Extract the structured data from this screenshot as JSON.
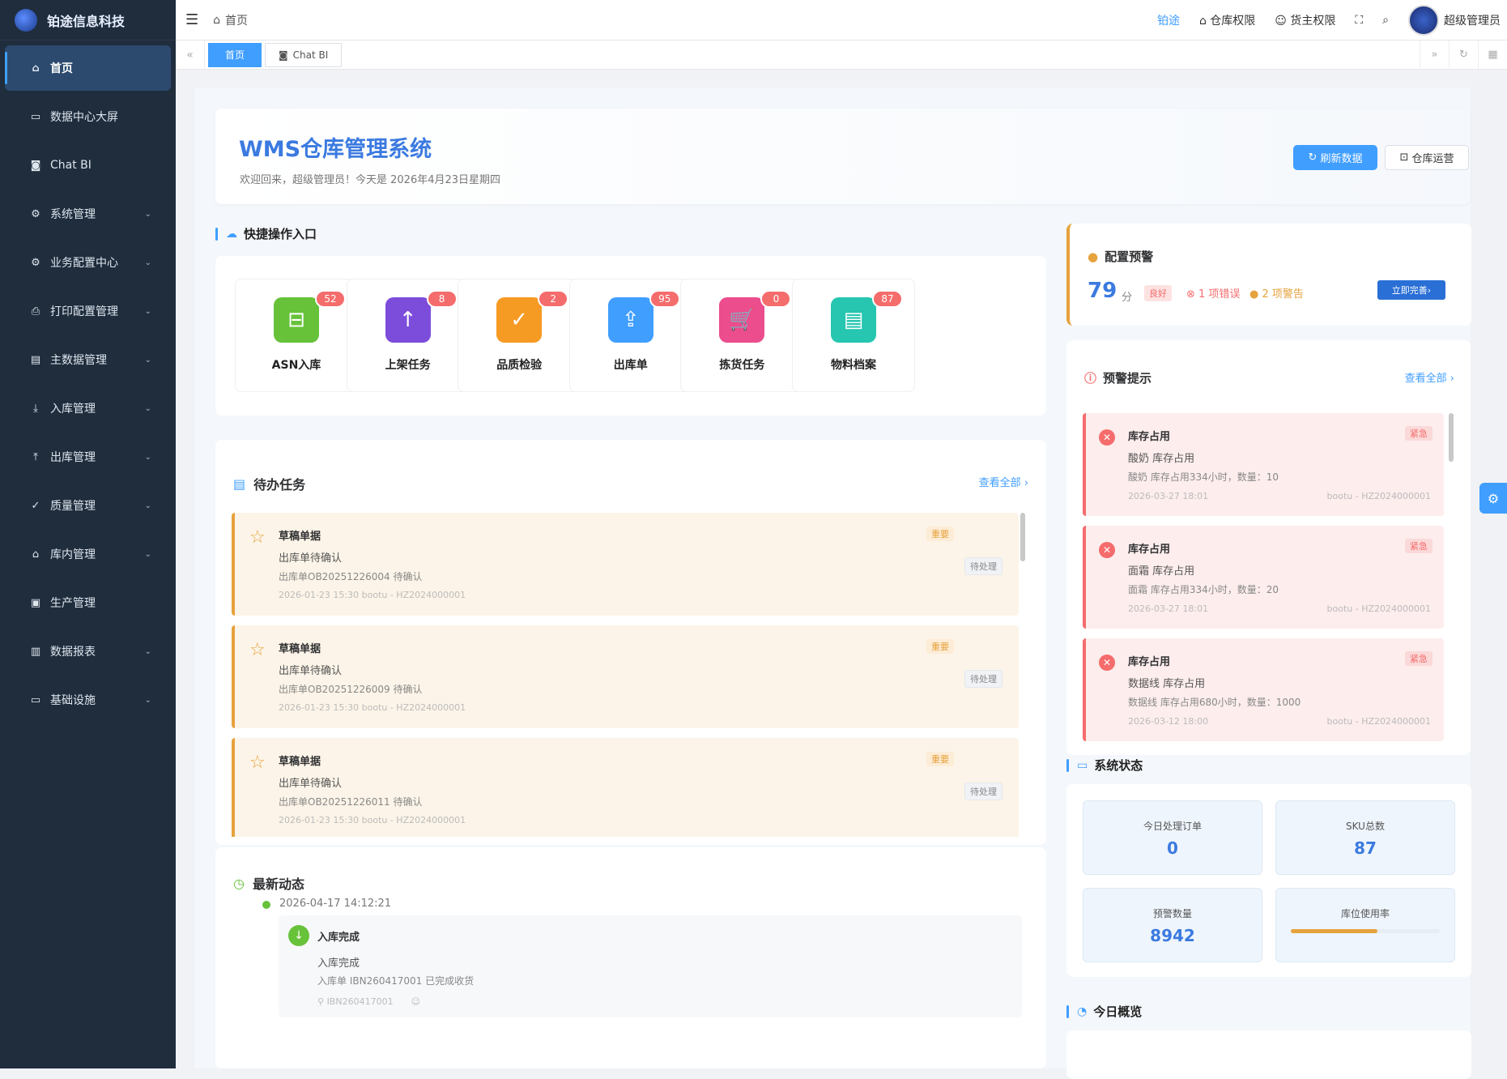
{
  "brand": {
    "name": "铂途信息科技"
  },
  "sidebar": {
    "items": [
      {
        "label": "首页",
        "icon": "home-icon"
      },
      {
        "label": "数据中心大屏",
        "icon": "monitor-icon"
      },
      {
        "label": "Chat BI",
        "icon": "chat-icon"
      },
      {
        "label": "系统管理",
        "icon": "gear-icon"
      },
      {
        "label": "业务配置中心",
        "icon": "settings-icon"
      },
      {
        "label": "打印配置管理",
        "icon": "printer-icon"
      },
      {
        "label": "主数据管理",
        "icon": "database-icon"
      },
      {
        "label": "入库管理",
        "icon": "download-icon"
      },
      {
        "label": "出库管理",
        "icon": "upload-icon"
      },
      {
        "label": "质量管理",
        "icon": "check-icon"
      },
      {
        "label": "库内管理",
        "icon": "warehouse-icon"
      },
      {
        "label": "生产管理",
        "icon": "briefcase-icon"
      },
      {
        "label": "数据报表",
        "icon": "chart-icon"
      },
      {
        "label": "基础设施",
        "icon": "monitor-icon"
      }
    ]
  },
  "topbar": {
    "breadcrumb": "首页",
    "company": "铂途",
    "warehouse_perm": "仓库权限",
    "owner_perm": "货主权限",
    "user": "超级管理员"
  },
  "tabs": [
    {
      "label": "首页"
    },
    {
      "label": "Chat BI"
    }
  ],
  "welcome": {
    "title": "WMS仓库管理系统",
    "subtitle": "欢迎回来，超级管理员！今天是 2026年4月23日星期四",
    "refresh": "刷新数据",
    "ops": "仓库运营"
  },
  "quick": {
    "title": "快捷操作入口",
    "items": [
      {
        "label": "ASN入库",
        "count": "52",
        "color": "#67c23a"
      },
      {
        "label": "上架任务",
        "count": "8",
        "color": "#7c4ddb"
      },
      {
        "label": "品质检验",
        "count": "2",
        "color": "#f59a23"
      },
      {
        "label": "出库单",
        "count": "95",
        "color": "#409eff"
      },
      {
        "label": "拣货任务",
        "count": "0",
        "color": "#eb4d8d"
      },
      {
        "label": "物料档案",
        "count": "87",
        "color": "#26c6b0"
      }
    ]
  },
  "todo": {
    "title": "待办任务",
    "more": "查看全部",
    "items": [
      {
        "title": "草稿单据",
        "desc": "出库单待确认",
        "detail": "出库单OB20251226004 待确认",
        "meta": "2026-01-23 15:30   bootu - HZ2024000001",
        "tag": "重要",
        "status": "待处理"
      },
      {
        "title": "草稿单据",
        "desc": "出库单待确认",
        "detail": "出库单OB20251226009 待确认",
        "meta": "2026-01-23 15:30   bootu - HZ2024000001",
        "tag": "重要",
        "status": "待处理"
      },
      {
        "title": "草稿单据",
        "desc": "出库单待确认",
        "detail": "出库单OB20251226011 待确认",
        "meta": "2026-01-23 15:30   bootu - HZ2024000001",
        "tag": "重要",
        "status": "待处理"
      }
    ]
  },
  "news": {
    "title": "最新动态",
    "time": "2026-04-17 14:12:21",
    "head": "入库完成",
    "desc": "入库完成",
    "detail": "入库单 IBN260417001 已完成收货",
    "ref": "IBN260417001"
  },
  "config": {
    "title": "配置预警",
    "score": "79",
    "unit": "分",
    "level": "良好",
    "errors": "1 项错误",
    "warnings": "2 项警告",
    "fix": "立即完善"
  },
  "alerts": {
    "title": "预警提示",
    "more": "查看全部",
    "items": [
      {
        "title": "库存占用",
        "desc": "酸奶 库存占用",
        "detail": "酸奶 库存占用334小时，数量：10",
        "time": "2026-03-27 18:01",
        "owner": "bootu - HZ2024000001",
        "tag": "紧急"
      },
      {
        "title": "库存占用",
        "desc": "面霜 库存占用",
        "detail": "面霜 库存占用334小时，数量：20",
        "time": "2026-03-27 18:01",
        "owner": "bootu - HZ2024000001",
        "tag": "紧急"
      },
      {
        "title": "库存占用",
        "desc": "数据线 库存占用",
        "detail": "数据线 库存占用680小时，数量：1000",
        "time": "2026-03-12 18:00",
        "owner": "bootu - HZ2024000001",
        "tag": "紧急"
      }
    ]
  },
  "system": {
    "title": "系统状态",
    "orders_label": "今日处理订单",
    "orders": "0",
    "sku_label": "SKU总数",
    "sku": "87",
    "warn_label": "预警数量",
    "warn": "8942",
    "usage_label": "库位使用率",
    "usage_fraction": 0.58
  },
  "today": {
    "title": "今日概览"
  }
}
